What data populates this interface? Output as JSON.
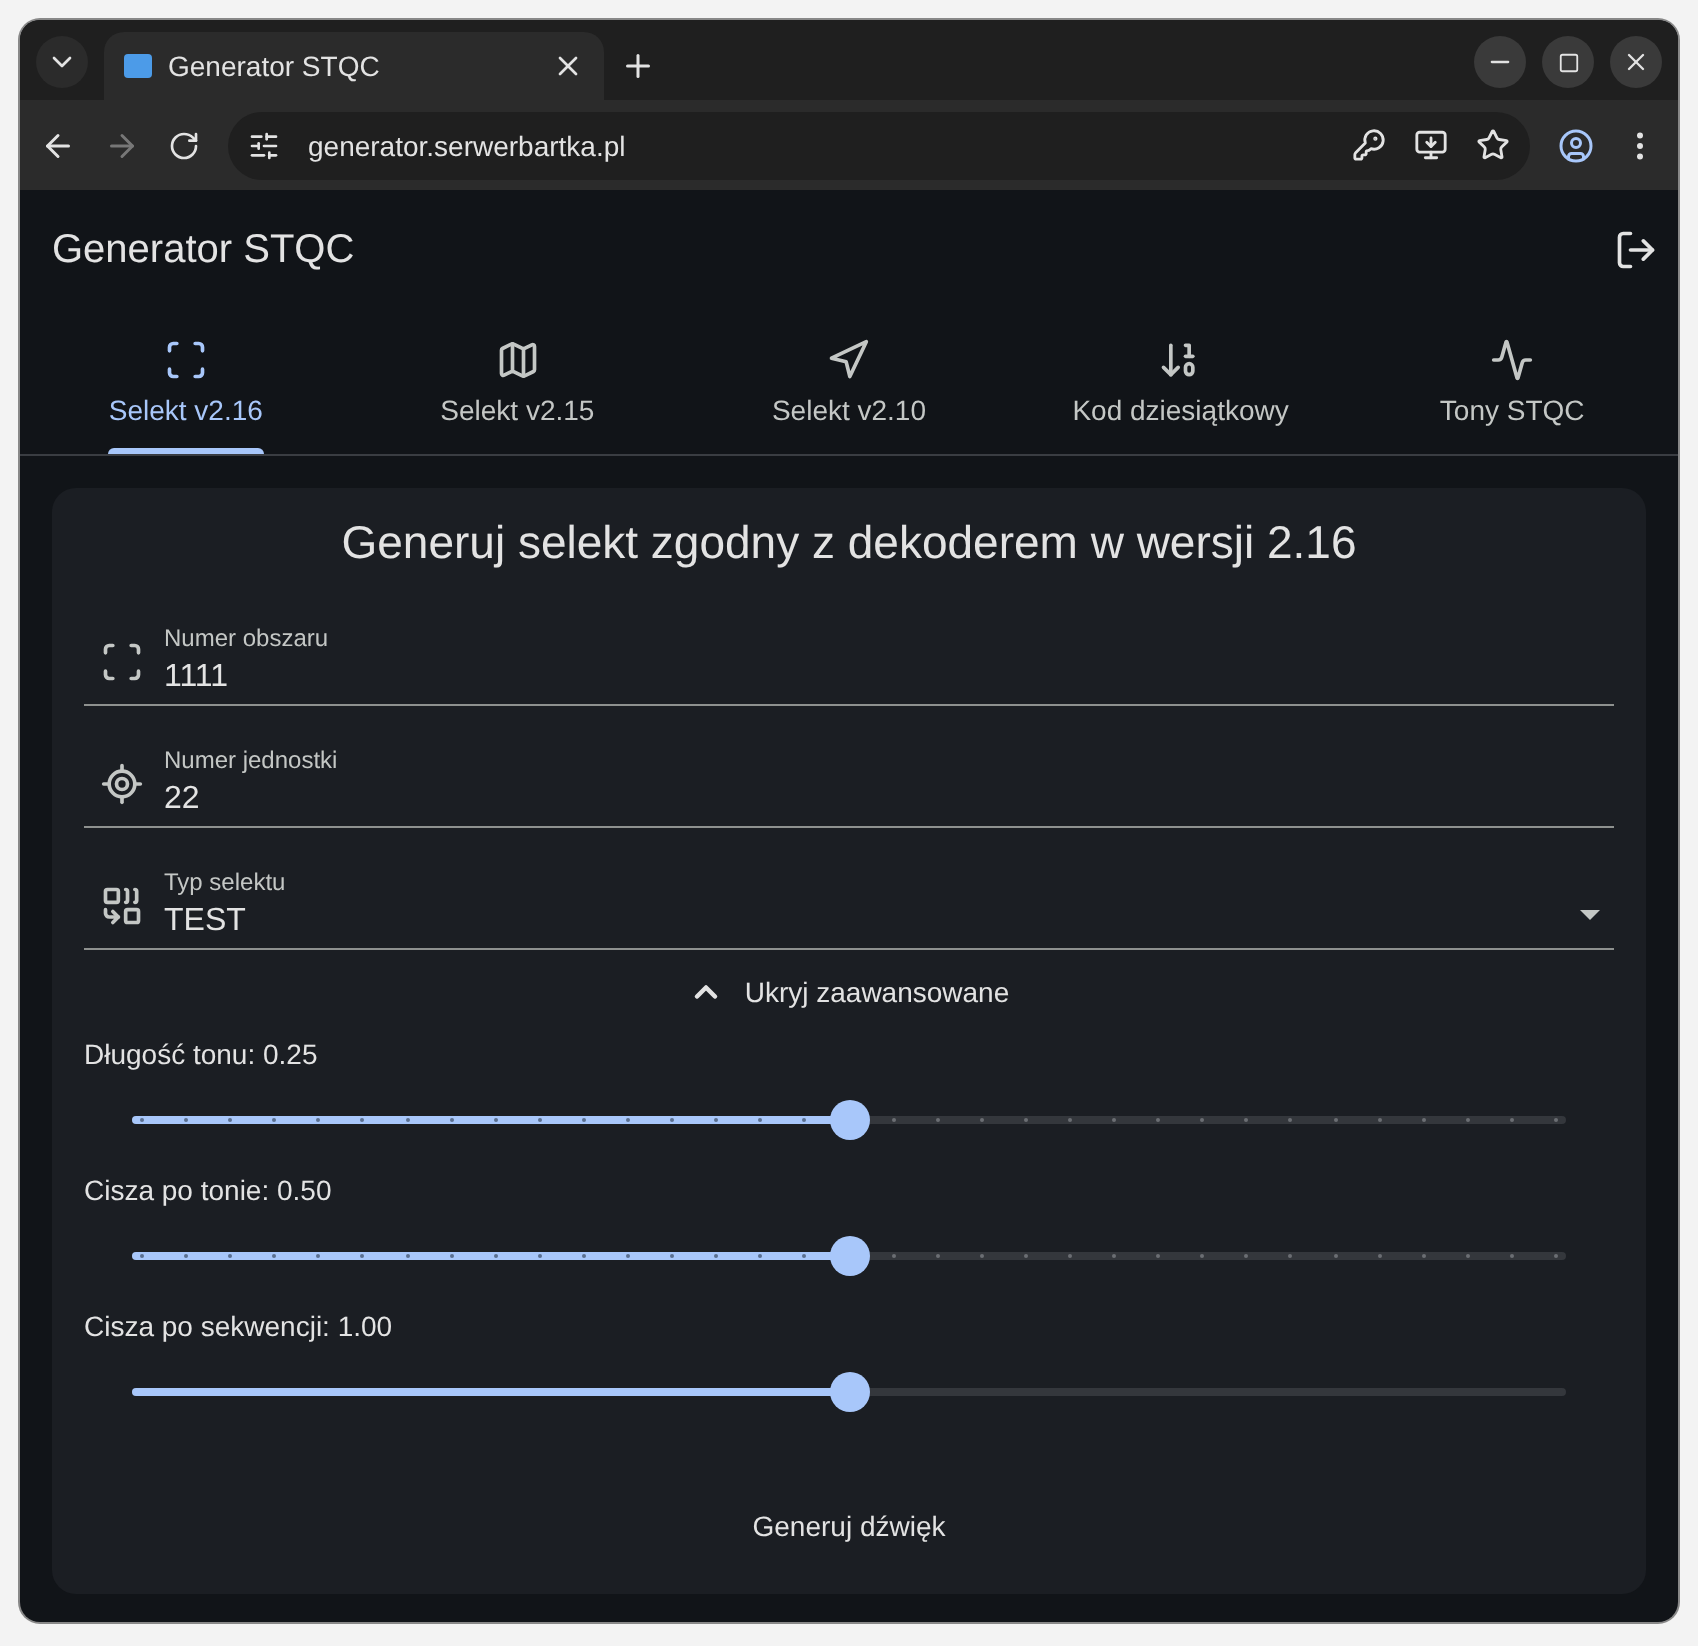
{
  "browser": {
    "tab_title": "Generator STQC",
    "url": "generator.serwerbartka.pl"
  },
  "app": {
    "title": "Generator STQC"
  },
  "tabs": [
    {
      "label": "Selekt v2.16",
      "selected": true
    },
    {
      "label": "Selekt v2.15",
      "selected": false
    },
    {
      "label": "Selekt v2.10",
      "selected": false
    },
    {
      "label": "Kod dziesiątkowy",
      "selected": false
    },
    {
      "label": "Tony STQC",
      "selected": false
    }
  ],
  "form": {
    "heading": "Generuj selekt zgodny z dekoderem w wersji 2.16",
    "fields": [
      {
        "kind": "text",
        "label": "Numer obszaru",
        "value": "1111"
      },
      {
        "kind": "text",
        "label": "Numer jednostki",
        "value": "22"
      },
      {
        "kind": "select",
        "label": "Typ selektu",
        "value": "TEST"
      }
    ],
    "advanced_toggle": {
      "label": "Ukryj zaawansowane",
      "expanded": true
    },
    "sliders": [
      {
        "label": "Długość tonu: 0.25",
        "level": 0.5,
        "marks": true
      },
      {
        "label": "Cisza po tonie: 0.50",
        "level": 0.5,
        "marks": true
      },
      {
        "label": "Cisza po sekwencji: 1.00",
        "level": 0.5,
        "marks": false
      }
    ],
    "submit": "Generuj dźwięk"
  }
}
